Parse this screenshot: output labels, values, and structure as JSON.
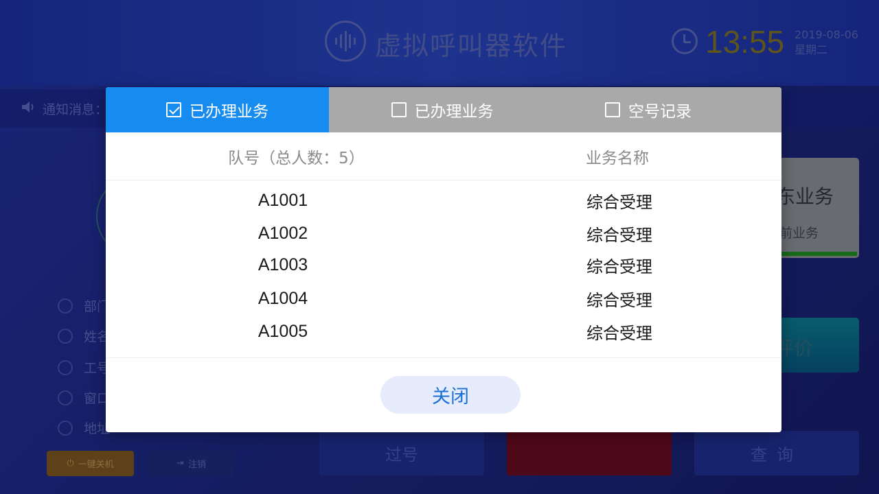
{
  "app": {
    "title": "虚拟呼叫器软件",
    "time": "13:55",
    "date": "2019-08-06",
    "weekday": "星期二",
    "notice_label": "通知消息：",
    "info_labels": [
      "部门",
      "姓名",
      "工号",
      "窗口",
      "地址"
    ],
    "shutdown_label": "一键关机",
    "logout_label": "注销",
    "current_service_title": "东业务",
    "current_service_sub": "前业务",
    "evaluate_label": "评价",
    "skip_label": "过号",
    "query_label": "查询"
  },
  "modal": {
    "tabs": [
      {
        "label": "已办理业务",
        "checked": true
      },
      {
        "label": "已办理业务",
        "checked": false
      },
      {
        "label": "空号记录",
        "checked": false
      }
    ],
    "columns": {
      "queue": "队号（总人数：5）",
      "service": "业务名称"
    },
    "rows": [
      {
        "queue": "A1001",
        "service": "综合受理"
      },
      {
        "queue": "A1002",
        "service": "综合受理"
      },
      {
        "queue": "A1003",
        "service": "综合受理"
      },
      {
        "queue": "A1004",
        "service": "综合受理"
      },
      {
        "queue": "A1005",
        "service": "综合受理"
      }
    ],
    "close_label": "关闭"
  },
  "colors": {
    "active_tab": "#168cf0",
    "inactive_tab": "#a9a9a9",
    "close_button_bg": "#e6ecfb",
    "close_button_text": "#1a6fd8"
  }
}
